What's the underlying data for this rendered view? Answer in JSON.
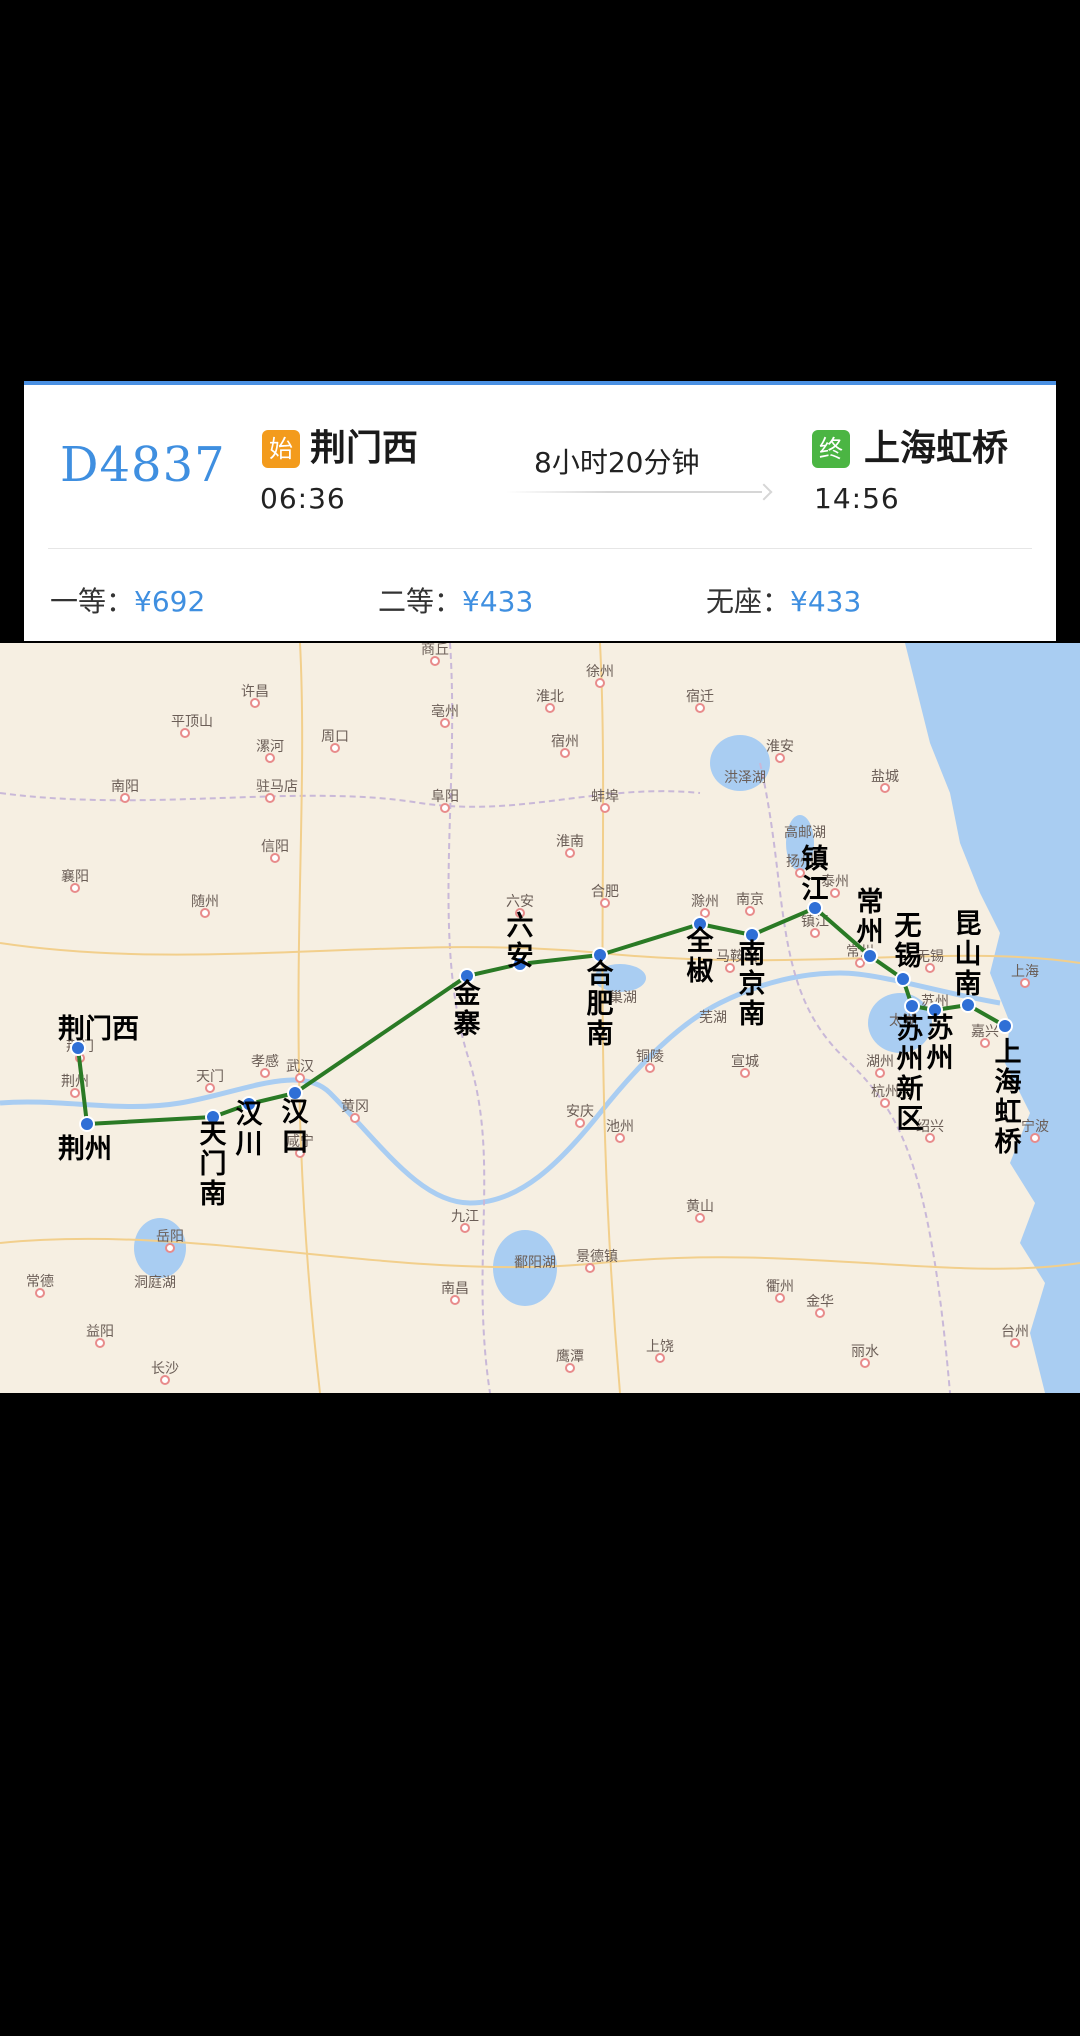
{
  "ticket": {
    "train_number": "D4837",
    "origin": {
      "badge": "始",
      "name": "荆门西",
      "time": "06:36"
    },
    "destination": {
      "badge": "终",
      "name": "上海虹桥",
      "time": "14:56"
    },
    "duration": "8小时20分钟",
    "fares": [
      {
        "class": "一等：",
        "price": "¥692"
      },
      {
        "class": "二等：",
        "price": "¥433"
      },
      {
        "class": "无座：",
        "price": "¥433"
      }
    ]
  },
  "map": {
    "route_color": "#2a7a25",
    "stop_color": "#2f6fd6",
    "stations": [
      "荆门西",
      "荆州",
      "天门南",
      "汉川",
      "汉口",
      "金寨",
      "六安",
      "合肥南",
      "全椒",
      "南京南",
      "镇江",
      "常州",
      "无锡",
      "苏州新区",
      "苏州",
      "昆山南",
      "上海虹桥"
    ],
    "cities": [
      "商丘",
      "徐州",
      "宿迁",
      "淮北",
      "亳州",
      "宿州",
      "淮安",
      "洪泽湖",
      "盐城",
      "许昌",
      "平顶山",
      "漯河",
      "周口",
      "南阳",
      "驻马店",
      "阜阳",
      "蚌埠",
      "高邮湖",
      "扬州",
      "淮南",
      "泰州",
      "信阳",
      "六安",
      "合肥",
      "南京",
      "镇江",
      "常州",
      "无锡",
      "苏州",
      "上海",
      "嘉兴",
      "湖州",
      "杭州",
      "绍兴",
      "宁波",
      "襄阳",
      "随州",
      "孝感",
      "武汉",
      "黄冈",
      "滁州",
      "马鞍山",
      "芜湖",
      "宣城",
      "铜陵",
      "池州",
      "安庆",
      "巢湖",
      "太湖",
      "荆门",
      "荆州",
      "天门",
      "岳阳",
      "咸宁",
      "九江",
      "鄱阳湖",
      "景德镇",
      "黄山",
      "衢州",
      "金华",
      "丽水",
      "台州",
      "南昌",
      "上饶",
      "鹰潭",
      "常德",
      "洞庭湖",
      "益阳",
      "长沙"
    ]
  }
}
